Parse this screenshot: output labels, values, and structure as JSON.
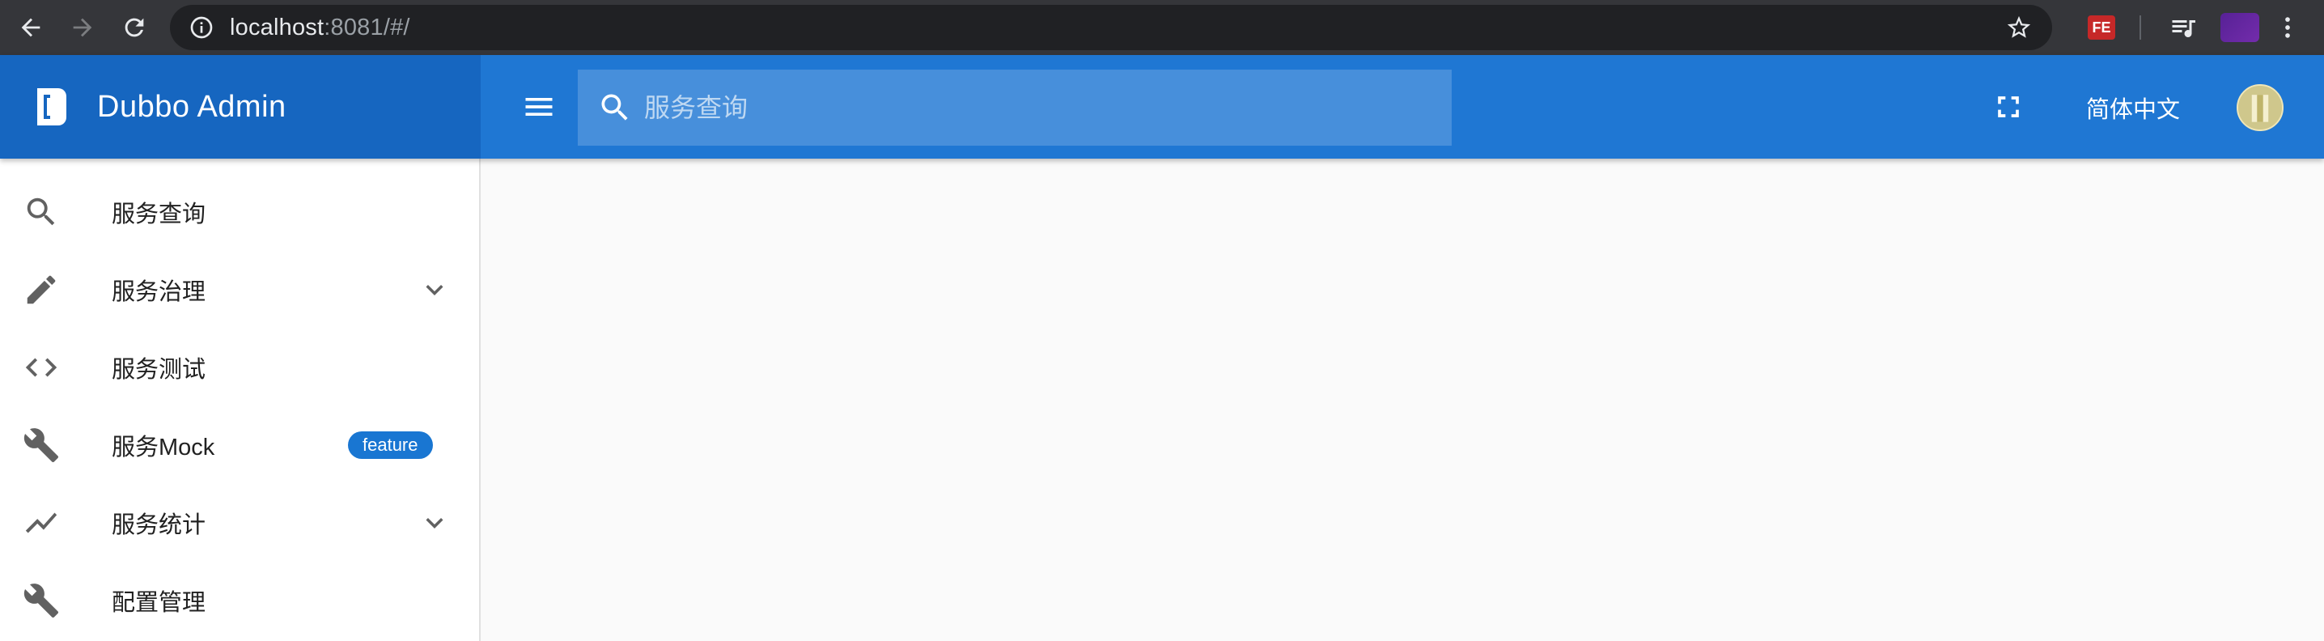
{
  "browser": {
    "url_host": "localhost",
    "url_rest": ":8081/#/",
    "extension_fe_label": "FE"
  },
  "app": {
    "brand_title": "Dubbo Admin",
    "search_placeholder": "服务查询",
    "language_label": "简体中文"
  },
  "sidebar": {
    "items": [
      {
        "label": "服务查询",
        "icon": "search-icon"
      },
      {
        "label": "服务治理",
        "icon": "pencil-icon",
        "expandable": true
      },
      {
        "label": "服务测试",
        "icon": "code-icon"
      },
      {
        "label": "服务Mock",
        "icon": "wrench-icon",
        "badge": "feature"
      },
      {
        "label": "服务统计",
        "icon": "trending-icon",
        "expandable": true
      },
      {
        "label": "配置管理",
        "icon": "wrench-icon"
      }
    ]
  },
  "colors": {
    "app_bar": "#1f77d3",
    "brand_bg": "#1666c0",
    "badge": "#1976d2",
    "chrome_bg": "#35363a"
  }
}
